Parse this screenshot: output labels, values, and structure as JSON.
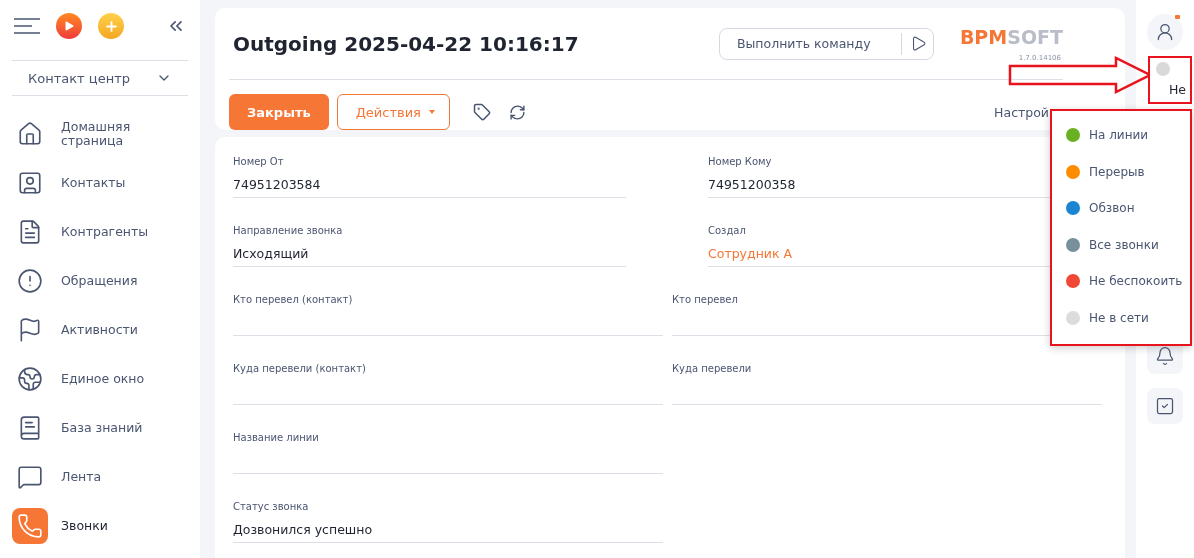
{
  "sidebar": {
    "workplace": "Контакт центр",
    "items": [
      {
        "label": "Домашняя страница",
        "selected": false
      },
      {
        "label": "Контакты",
        "selected": false
      },
      {
        "label": "Контрагенты",
        "selected": false
      },
      {
        "label": "Обращения",
        "selected": false
      },
      {
        "label": "Активности",
        "selected": false
      },
      {
        "label": "Единое окно",
        "selected": false
      },
      {
        "label": "База знаний",
        "selected": false
      },
      {
        "label": "Лента",
        "selected": false
      },
      {
        "label": "Звонки",
        "selected": true
      }
    ]
  },
  "header": {
    "title": "Outgoing 2025-04-22 10:16:17",
    "command": {
      "placeholder": "Выполнить команду"
    },
    "logo": {
      "part_1": "BPM",
      "part_2": "SOFT"
    },
    "version": "1.7.0.14106",
    "close_button": "Закрыть",
    "actions_button": "Действия",
    "settings": "Настрой"
  },
  "fields": [
    {
      "kind": "narrow",
      "label": "Номер От",
      "value": "74951203584"
    },
    {
      "kind": "narrow",
      "label": "Номер Кому",
      "value": "74951200358"
    },
    {
      "kind": "narrow",
      "label": "Направление звонка",
      "value": "Исходящий"
    },
    {
      "kind": "narrow",
      "label": "Создал",
      "value": "Сотрудник А",
      "link": true
    },
    {
      "kind": "wide",
      "label": "Кто перевел (контакт)"
    },
    {
      "kind": "wide",
      "label": "Кто перевел"
    },
    {
      "kind": "wide",
      "label": "Куда перевели (контакт)"
    },
    {
      "kind": "wide",
      "label": "Куда перевели"
    },
    {
      "kind": "wide",
      "label": "Название линии"
    },
    {
      "kind": "spacer"
    },
    {
      "kind": "wide",
      "label": "Статус звонка",
      "value": "Дозвонился успешно"
    }
  ],
  "status": {
    "color": "#d9d9d9",
    "label": "Не"
  },
  "status_menu": [
    {
      "label": "На линии",
      "color": "#6ab023"
    },
    {
      "label": "Перерыв",
      "color": "#ff8c00"
    },
    {
      "label": "Обзвон",
      "color": "#1a85d1"
    },
    {
      "label": "Все звонки",
      "color": "#78909c"
    },
    {
      "label": "Не беспокоить",
      "color": "#ef4836"
    },
    {
      "label": "Не в сети",
      "color": "#dcdcdc"
    }
  ]
}
